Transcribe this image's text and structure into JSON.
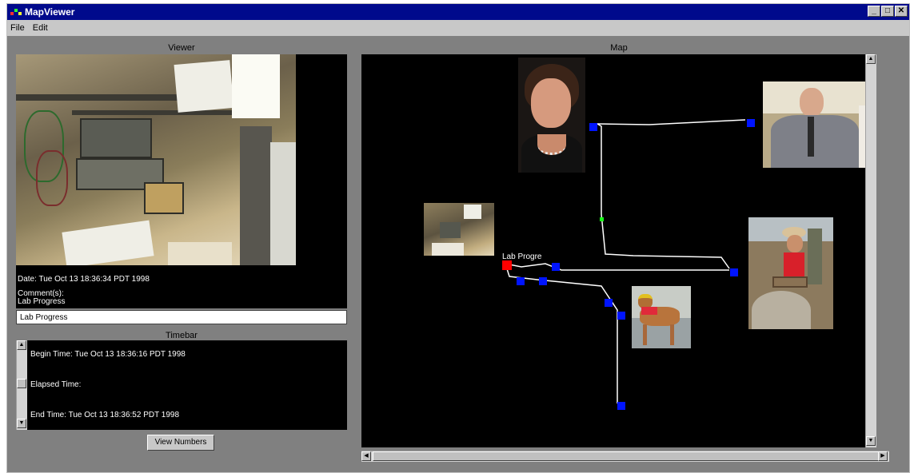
{
  "window": {
    "title": "MapViewer",
    "buttons": {
      "minimize": "_",
      "maximize": "□",
      "close": "✕"
    }
  },
  "menu": [
    "File",
    "Edit"
  ],
  "viewer": {
    "title": "Viewer",
    "date_line": "Date: Tue Oct 13 18:36:34 PDT 1998",
    "comment_label": "Comment(s):",
    "comment_text": "Lab Progress",
    "comment_input_value": "Lab Progress"
  },
  "timebar": {
    "title": "Timebar",
    "begin": "Begin Time: Tue Oct 13 18:36:16 PDT 1998",
    "elapsed": "Elapsed Time:",
    "end": "End Time: Tue Oct 13 18:36:52 PDT 1998"
  },
  "view_numbers_label": "View Numbers",
  "map": {
    "title": "Map",
    "node_label": "Lab Progre"
  },
  "colors": {
    "node": "#0014ff",
    "current_node": "#ff0000",
    "waypoint": "#18ff18",
    "titlebar": "#000a8c"
  },
  "icons": {
    "app": "mapviewer-app-icon",
    "scroll_up": "scroll-up-arrow-icon",
    "scroll_down": "scroll-down-arrow-icon",
    "scroll_left": "scroll-left-arrow-icon",
    "scroll_right": "scroll-right-arrow-icon"
  }
}
